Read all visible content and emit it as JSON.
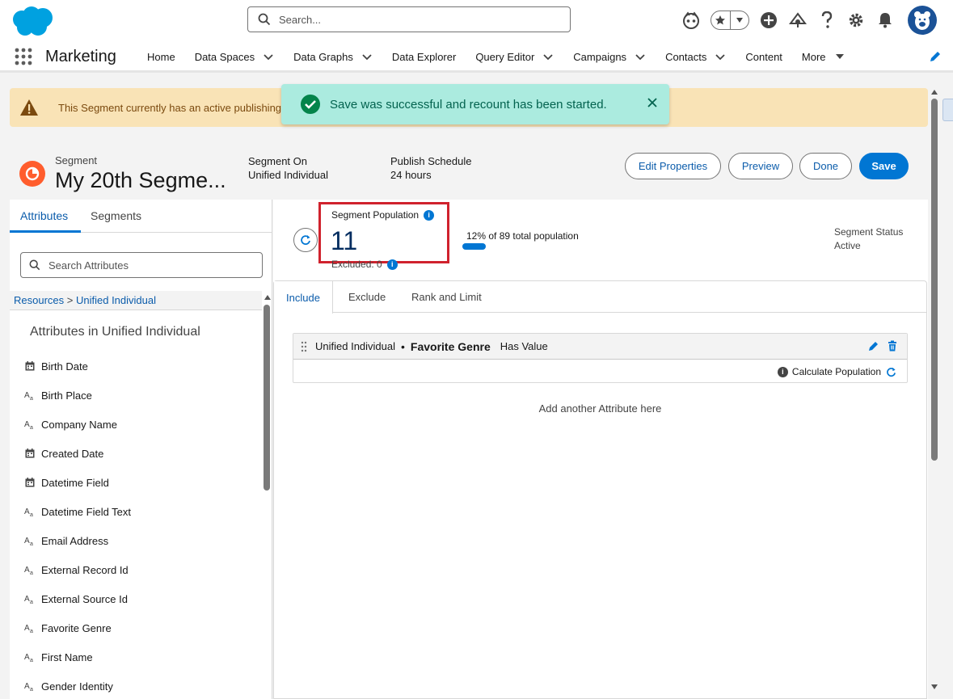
{
  "header": {
    "search_placeholder": "Search..."
  },
  "nav": {
    "app_name": "Marketing",
    "items": [
      {
        "label": "Home",
        "has_menu": false
      },
      {
        "label": "Data Spaces",
        "has_menu": true
      },
      {
        "label": "Data Graphs",
        "has_menu": true
      },
      {
        "label": "Data Explorer",
        "has_menu": false
      },
      {
        "label": "Query Editor",
        "has_menu": true
      },
      {
        "label": "Campaigns",
        "has_menu": true
      },
      {
        "label": "Contacts",
        "has_menu": true
      },
      {
        "label": "Content",
        "has_menu": false
      },
      {
        "label": "More",
        "has_menu": true
      }
    ]
  },
  "banner": {
    "warning_text": "This Segment currently has an active publishing"
  },
  "toast": {
    "message": "Save was successful and recount has been started."
  },
  "segment": {
    "type_label": "Segment",
    "name": "My 20th Segme...",
    "segment_on_label": "Segment On",
    "segment_on_value": "Unified Individual",
    "publish_label": "Publish Schedule",
    "publish_value": "24 hours",
    "buttons": {
      "edit": "Edit Properties",
      "preview": "Preview",
      "done": "Done",
      "save": "Save"
    }
  },
  "left_panel": {
    "tabs": [
      "Attributes",
      "Segments"
    ],
    "search_placeholder": "Search Attributes",
    "breadcrumb_root": "Resources",
    "breadcrumb_sep": ">",
    "breadcrumb_child": "Unified Individual",
    "heading": "Attributes in Unified Individual",
    "attributes": [
      {
        "label": "Birth Date",
        "icon": "calendar-icon"
      },
      {
        "label": "Birth Place",
        "icon": "text-icon"
      },
      {
        "label": "Company Name",
        "icon": "text-icon"
      },
      {
        "label": "Created Date",
        "icon": "calendar-icon"
      },
      {
        "label": "Datetime Field",
        "icon": "calendar-icon"
      },
      {
        "label": "Datetime Field Text",
        "icon": "text-icon"
      },
      {
        "label": "Email Address",
        "icon": "text-icon"
      },
      {
        "label": "External Record Id",
        "icon": "text-icon"
      },
      {
        "label": "External Source Id",
        "icon": "text-icon"
      },
      {
        "label": "Favorite Genre",
        "icon": "text-icon"
      },
      {
        "label": "First Name",
        "icon": "text-icon"
      },
      {
        "label": "Gender Identity",
        "icon": "text-icon"
      }
    ]
  },
  "population": {
    "label": "Segment Population",
    "value": "11",
    "excluded": "Excluded: 0",
    "percent_text": "12% of 89 total population",
    "percent": 0.12,
    "status_label": "Segment Status",
    "status_value": "Active"
  },
  "rules": {
    "tabs": [
      "Include",
      "Exclude",
      "Rank and Limit"
    ],
    "rule": {
      "object": "Unified Individual",
      "field": "Favorite Genre",
      "operator": "Has Value"
    },
    "calculate_label": "Calculate Population",
    "add_another": "Add another Attribute here"
  },
  "colors": {
    "brand": "#0176d3",
    "success": "#04844b",
    "warning_bg": "#f9e3b6",
    "toast_bg": "#abebdf",
    "highlight": "#d0222d"
  }
}
